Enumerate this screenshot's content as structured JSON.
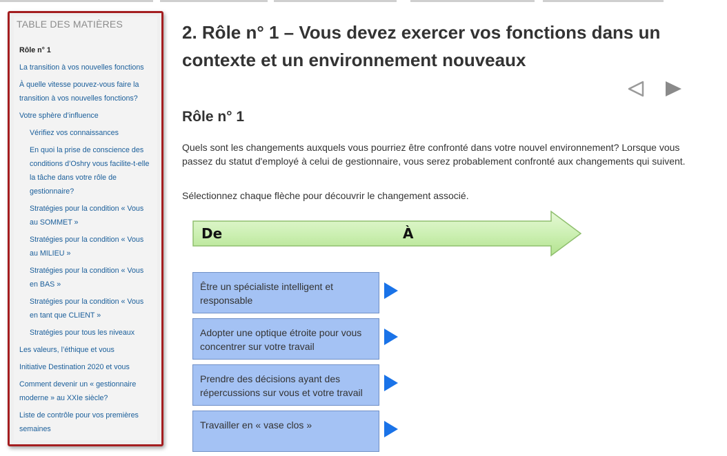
{
  "toc": {
    "title": "TABLE DES MATIÈRES",
    "items": [
      {
        "label": "Rôle n° 1",
        "level": 0,
        "current": true
      },
      {
        "label": "La transition à vos nouvelles fonctions",
        "level": 0
      },
      {
        "label": "À quelle vitesse pouvez-vous faire la transition à vos nouvelles fonctions?",
        "level": 0
      },
      {
        "label": "Votre sphère d’influence",
        "level": 0
      },
      {
        "label": "Vérifiez vos connaissances",
        "level": 1
      },
      {
        "label": "En quoi la prise de conscience des conditions d’Oshry vous facilite-t-elle la tâche dans votre rôle de gestionnaire?",
        "level": 1
      },
      {
        "label": "Stratégies pour la condition « Vous au SOMMET »",
        "level": 1
      },
      {
        "label": "Stratégies pour la condition « Vous au MILIEU »",
        "level": 1
      },
      {
        "label": "Stratégies pour la condition « Vous en BAS »",
        "level": 1
      },
      {
        "label": "Stratégies pour la condition « Vous en tant que CLIENT »",
        "level": 1
      },
      {
        "label": "Stratégies pour tous les niveaux",
        "level": 1
      },
      {
        "label": "Les valeurs, l’éthique et vous",
        "level": 0
      },
      {
        "label": "Initiative Destination 2020 et vous",
        "level": 0
      },
      {
        "label": "Comment devenir un « gestionnaire moderne » au XXIe siècle?",
        "level": 0
      },
      {
        "label": "Liste de contrôle pour vos premières semaines",
        "level": 0
      }
    ]
  },
  "main": {
    "title": "2. Rôle n° 1 – Vous devez exercer vos fonctions dans un contexte et un environnement nouveaux",
    "section_title": "Rôle n° 1",
    "intro": "Quels sont les changements auxquels vous pourriez être confronté dans votre nouvel environnement? Lorsque vous passez du statut d'employé à celui de gestionnaire, vous serez probablement confronté aux changements qui suivent.",
    "instruction": "Sélectionnez chaque flèche pour découvrir le changement associé.",
    "arrow": {
      "from_label": "De",
      "to_label": "À"
    },
    "changes": [
      {
        "label": "Être un spécialiste intelligent et responsable"
      },
      {
        "label": "Adopter une optique étroite pour vous concentrer sur votre travail"
      },
      {
        "label": "Prendre des décisions ayant des répercussions sur vous et votre travail"
      },
      {
        "label": "Travailler en « vase clos »"
      }
    ]
  },
  "colors": {
    "toc_border": "#a41d1f",
    "toc_link": "#1a5e9a",
    "change_box": "#a4c2f4",
    "change_arrow": "#1a73e8",
    "banner_arrow": "#ccf0b2"
  },
  "icons": {
    "prev": "triangle-left-outline-icon",
    "next": "triangle-right-filled-icon",
    "change": "triangle-right-blue-icon"
  }
}
